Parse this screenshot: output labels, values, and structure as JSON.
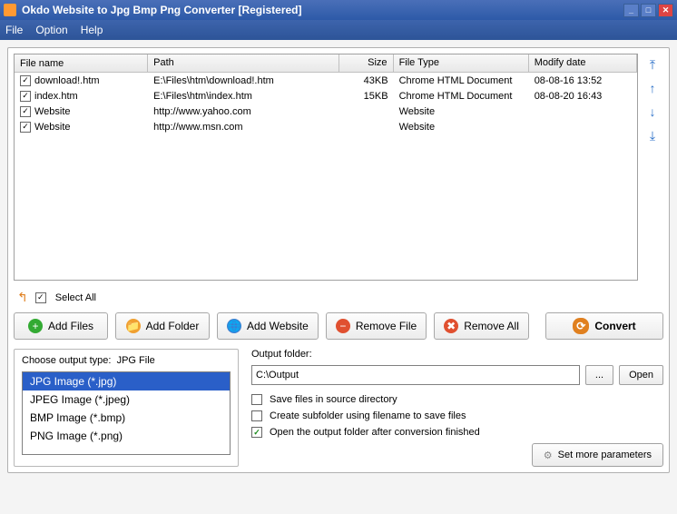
{
  "title": "Okdo Website to Jpg Bmp Png Converter [Registered]",
  "menu": {
    "file": "File",
    "option": "Option",
    "help": "Help"
  },
  "columns": {
    "name": "File name",
    "path": "Path",
    "size": "Size",
    "type": "File Type",
    "date": "Modify date"
  },
  "rows": [
    {
      "checked": true,
      "name": "download!.htm",
      "path": "E:\\Files\\htm\\download!.htm",
      "size": "43KB",
      "type": "Chrome HTML Document",
      "date": "08-08-16 13:52"
    },
    {
      "checked": true,
      "name": "index.htm",
      "path": "E:\\Files\\htm\\index.htm",
      "size": "15KB",
      "type": "Chrome HTML Document",
      "date": "08-08-20 16:43"
    },
    {
      "checked": true,
      "name": "Website",
      "path": "http://www.yahoo.com",
      "size": "",
      "type": "Website",
      "date": ""
    },
    {
      "checked": true,
      "name": "Website",
      "path": "http://www.msn.com",
      "size": "",
      "type": "Website",
      "date": ""
    }
  ],
  "selectAll": {
    "label": "Select All",
    "checked": true
  },
  "buttons": {
    "addFiles": "Add Files",
    "addFolder": "Add Folder",
    "addWebsite": "Add Website",
    "removeFile": "Remove File",
    "removeAll": "Remove All",
    "convert": "Convert"
  },
  "outputType": {
    "label": "Choose output type:",
    "current": "JPG File",
    "options": [
      "JPG Image (*.jpg)",
      "JPEG Image (*.jpeg)",
      "BMP Image (*.bmp)",
      "PNG Image (*.png)"
    ],
    "selectedIndex": 0
  },
  "outputFolder": {
    "label": "Output folder:",
    "value": "C:\\Output",
    "browse": "...",
    "open": "Open"
  },
  "options": {
    "saveSource": {
      "label": "Save files in source directory",
      "checked": false
    },
    "subfolder": {
      "label": "Create subfolder using filename to save files",
      "checked": false
    },
    "openAfter": {
      "label": "Open the output folder after conversion finished",
      "checked": true
    }
  },
  "moreParams": "Set more parameters"
}
